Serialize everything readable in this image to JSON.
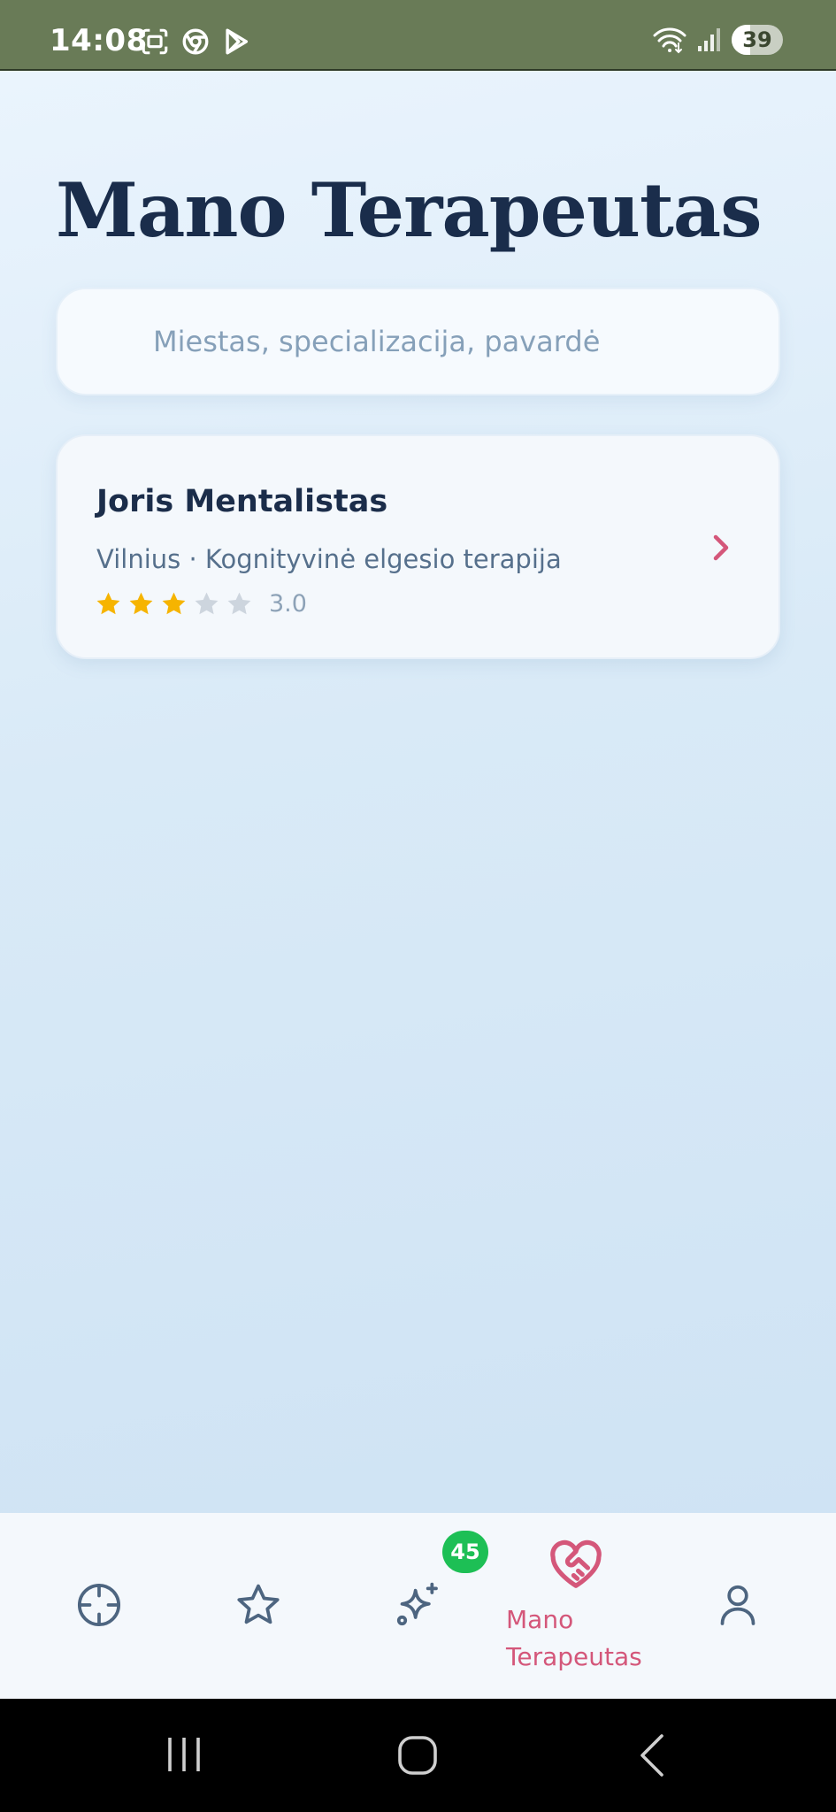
{
  "status_bar": {
    "time": "14:08",
    "battery": "39",
    "left_icons": [
      "screenshot-icon",
      "chrome-icon",
      "play-store-icon"
    ],
    "right_icons": [
      "wifi-icon",
      "signal-icon",
      "battery-icon"
    ]
  },
  "page": {
    "title": "Mano Terapeutas"
  },
  "search": {
    "placeholder": "Miestas, specializacija, pavardė"
  },
  "therapists": [
    {
      "name": "Joris Mentalistas",
      "subtitle": "Vilnius · Kognityvinė elgesio terapija",
      "rating": 3.0,
      "rating_text": "3.0",
      "stars_max": 5
    }
  ],
  "bottom_nav": {
    "items": [
      {
        "icon": "crosshair-icon",
        "label": ""
      },
      {
        "icon": "star-icon",
        "label": ""
      },
      {
        "icon": "sparkles-icon",
        "label": "",
        "badge": "45"
      },
      {
        "icon": "heart-handshake-icon",
        "label": "Mano Terapeutas",
        "active": true
      },
      {
        "icon": "user-icon",
        "label": ""
      }
    ],
    "active_label_line1": "Mano",
    "active_label_line2": "Terapeutas",
    "badge": "45"
  },
  "colors": {
    "title": "#1a2d4b",
    "accent": "#d4577a",
    "star_filled": "#f6b400",
    "star_empty": "#cdd5de",
    "badge": "#1dbf55",
    "status_bar": "#697b57"
  }
}
